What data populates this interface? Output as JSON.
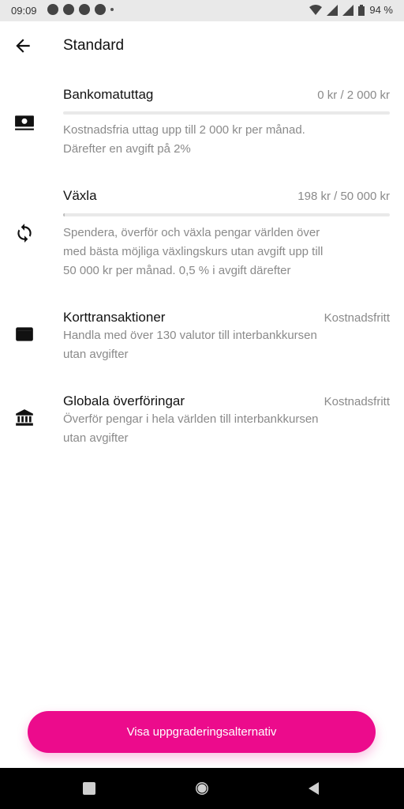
{
  "status_bar": {
    "time": "09:09",
    "battery": "94 %"
  },
  "header": {
    "title": "Standard"
  },
  "sections": [
    {
      "title": "Bankomatuttag",
      "value": "0 kr / 2 000 kr",
      "progress": 0.0,
      "icon": "cash-icon",
      "description_lines": [
        "Kostnadsfria uttag upp till 2 000 kr per månad.",
        "Därefter en avgift på 2%"
      ]
    },
    {
      "title": "Växla",
      "value": "198 kr / 50 000 kr",
      "progress": 0.004,
      "icon": "exchange-icon",
      "description_lines": [
        "Spendera, överför och växla pengar världen över",
        "med bästa möjliga växlingskurs utan avgift upp till",
        "50 000 kr per månad. 0,5 % i avgift därefter"
      ]
    },
    {
      "title": "Korttransaktioner",
      "value": "Kostnadsfritt",
      "icon": "card-icon",
      "description_lines": [
        "Handla med över 130 valutor till interbankkursen",
        "utan avgifter"
      ]
    },
    {
      "title": "Globala överföringar",
      "value": "Kostnadsfritt",
      "icon": "bank-icon",
      "description_lines": [
        "Överför pengar i hela världen till interbankkursen",
        "utan avgifter"
      ]
    }
  ],
  "cta": {
    "label": "Visa uppgraderingsalternativ"
  },
  "colors": {
    "accent": "#ec0b8c",
    "muted_text": "#8a8a8a",
    "track": "#e9e9e9"
  }
}
